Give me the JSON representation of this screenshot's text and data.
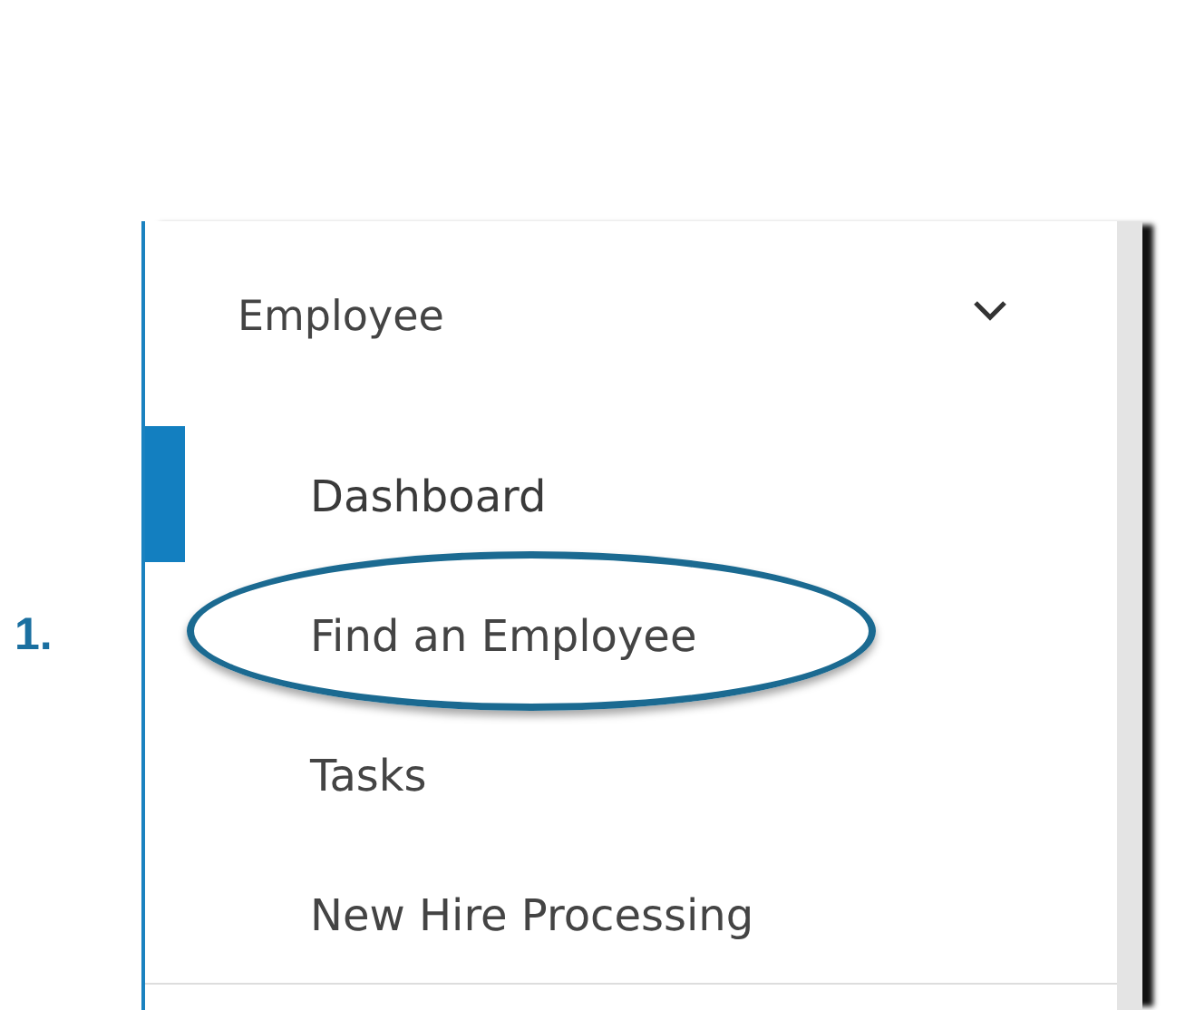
{
  "menu": {
    "title": "Employee",
    "expanded": true,
    "items": [
      {
        "label": "Dashboard",
        "selected": true,
        "circled": false
      },
      {
        "label": "Find an Employee",
        "selected": false,
        "circled": true
      },
      {
        "label": "Tasks",
        "selected": false,
        "circled": false
      },
      {
        "label": "New Hire Processing",
        "selected": false,
        "circled": false
      }
    ]
  },
  "annotation": {
    "label": "1."
  }
}
